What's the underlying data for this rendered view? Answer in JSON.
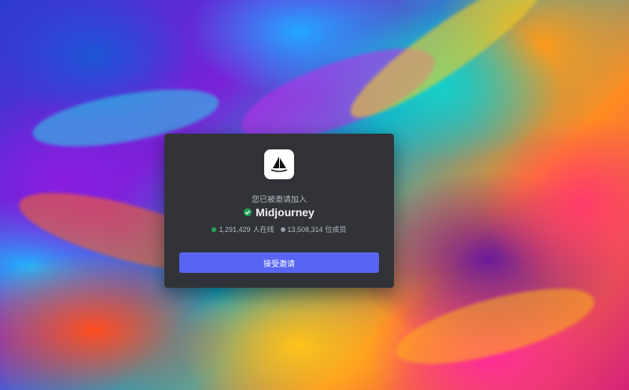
{
  "invite": {
    "prompt": "您已被邀请加入",
    "server_name": "Midjourney",
    "online_count": "1,291,429",
    "online_label": "人在线",
    "member_count": "13,508,314",
    "member_label": "位成员",
    "accept_label": "接受邀请",
    "server_icon": "sailboat-icon",
    "verified_icon": "verified-check-icon"
  },
  "colors": {
    "card_bg": "#313338",
    "button": "#5865f2",
    "online_dot": "#23a55a",
    "member_dot": "#949ba4",
    "verified": "#23a55a"
  }
}
